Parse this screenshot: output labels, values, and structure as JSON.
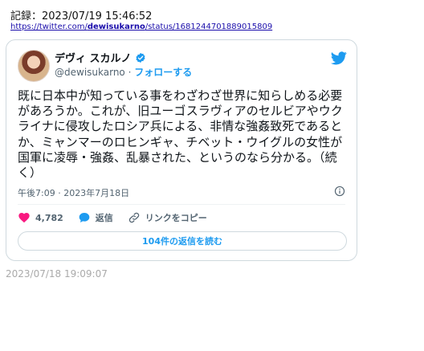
{
  "record": {
    "label": "記録：2023/07/19 15:46:52",
    "url_prefix": "https://twitter.com/",
    "url_user": "dewisukarno",
    "url_suffix": "/status/1681244701889015809"
  },
  "tweet": {
    "display_name": "デヴィ スカルノ",
    "handle": "@dewisukarno",
    "separator": "·",
    "follow_label": "フォローする",
    "text": "既に日本中が知っている事をわざわざ世界に知らしめる必要があろうか。これが、旧ユーゴスラヴィアのセルビアやウクライナに侵攻したロシア兵による、非情な強姦致死であるとか、ミャンマーのロヒンギャ、チベット・ウイグルの女性が国軍に凌辱・強姦、乱暴された、というのなら分かる。（続く）",
    "timestamp": "午後7:09 · 2023年7月18日",
    "like_count": "4,782",
    "reply_label": "返信",
    "copy_link_label": "リンクをコピー",
    "replies_button_label": "104件の返信を読む",
    "colors": {
      "accent": "#1d9bf0",
      "like": "#f91880",
      "muted": "#536471"
    },
    "icons": [
      "verified-badge-icon",
      "twitter-bird-icon",
      "info-icon",
      "heart-icon",
      "reply-bubble-icon",
      "link-icon"
    ]
  },
  "footer": {
    "time": "2023/07/18 19:09:07"
  }
}
